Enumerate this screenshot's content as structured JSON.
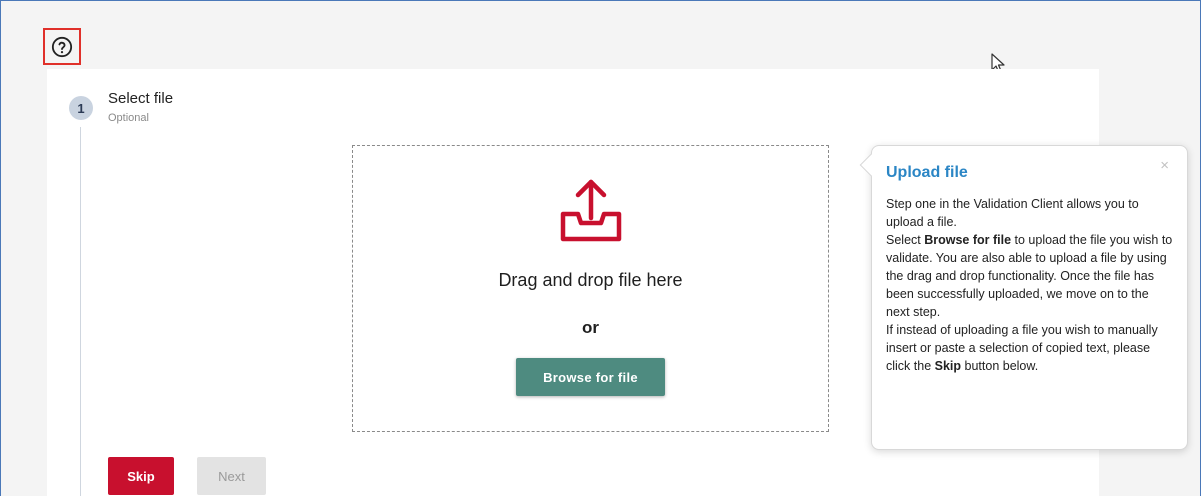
{
  "help": {
    "icon": "help-circle-icon"
  },
  "stepper": {
    "step_number": "1",
    "step_title": "Select file",
    "step_optional": "Optional"
  },
  "dropzone": {
    "icon": "upload-icon",
    "drag_text": "Drag and drop file here",
    "or_text": "or",
    "browse_label": "Browse for file"
  },
  "actions": {
    "skip_label": "Skip",
    "next_label": "Next"
  },
  "tooltip": {
    "title": "Upload file",
    "close_glyph": "×",
    "p1": "Step one in the Validation Client allows you to upload a file.",
    "p2_pre": "Select ",
    "p2_bold": "Browse for file",
    "p2_post": " to upload the file you wish to validate. You are also able to upload a file by using the drag and drop functionality. Once the file has been successfully uploaded, we move on to the next step.",
    "p3_pre": "If instead of uploading a file you wish to manually insert or paste a selection of copied text, please click the ",
    "p3_bold": "Skip",
    "p3_post": " button below."
  },
  "colors": {
    "accent_red": "#c8102e",
    "browse_green": "#4e8b80",
    "tooltip_title_blue": "#2b86c5",
    "highlight_border": "#e0302a"
  }
}
